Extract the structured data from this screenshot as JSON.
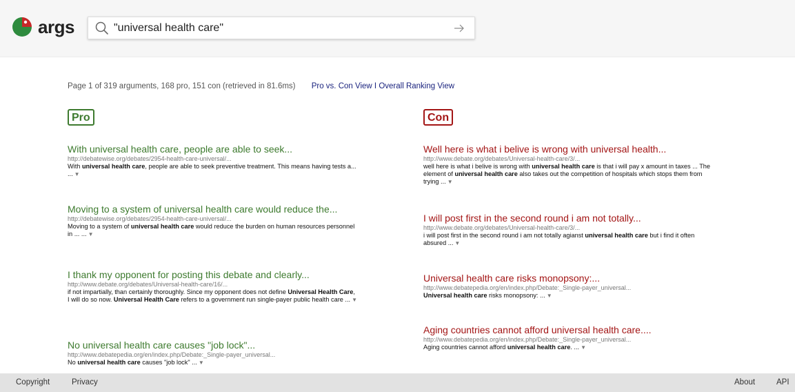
{
  "header": {
    "logo_text": "args",
    "search_value": "\"universal health care\""
  },
  "meta": {
    "summary": "Page 1 of 319 arguments, 168 pro, 151 con (retrieved in 81.6ms)",
    "view_pro_con": "Pro vs. Con View",
    "separator": "I",
    "view_ranking": "Overall Ranking View"
  },
  "pro": {
    "label": "Pro",
    "results": [
      {
        "title": "With universal health care, people are able to seek...",
        "url": "http://debatewise.org/debates/2954-health-care-universal/...",
        "snippet": [
          {
            "t": "With "
          },
          {
            "t": "universal health care",
            "b": true
          },
          {
            "t": ", people are able to seek preventive treatment. This means having tests a... ..."
          }
        ]
      },
      {
        "title": "Moving to a system of universal health care would reduce the...",
        "url": "http://debatewise.org/debates/2954-health-care-universal/...",
        "snippet": [
          {
            "t": "Moving to a system of "
          },
          {
            "t": "universal health care",
            "b": true
          },
          {
            "t": " would reduce the burden on human resources personnel in ... ..."
          }
        ]
      },
      {
        "title": "I thank my opponent for posting this debate and clearly...",
        "url": "http://www.debate.org/debates/Universal-health-care/16/...",
        "snippet": [
          {
            "t": "if not impartially, than certainly thoroughly. Since my opponent does not define "
          },
          {
            "t": "Universal Health Care",
            "b": true
          },
          {
            "t": ", I will do so now. "
          },
          {
            "t": "Universal Health Care",
            "b": true
          },
          {
            "t": " refers to a government run single-payer public health care ..."
          }
        ]
      },
      {
        "title": "No universal health care causes \"job lock\"...",
        "url": "http://www.debatepedia.org/en/index.php/Debate:_Single-payer_universal...",
        "snippet": [
          {
            "t": "No "
          },
          {
            "t": "universal health care",
            "b": true
          },
          {
            "t": " causes \"job lock\" ..."
          }
        ]
      }
    ]
  },
  "con": {
    "label": "Con",
    "results": [
      {
        "title": "Well here is what i belive is wrong with universal health...",
        "url": "http://www.debate.org/debates/Universal-health-care/3/...",
        "snippet": [
          {
            "t": "well here is what i belive is wrong with "
          },
          {
            "t": "universal health care",
            "b": true
          },
          {
            "t": " is that i will pay x amount in taxes ... The element of "
          },
          {
            "t": "universal health care",
            "b": true
          },
          {
            "t": " also takes out the competition of hospitals which stops them from trying ..."
          }
        ]
      },
      {
        "title": "I will post first in the second round i am not totally...",
        "url": "http://www.debate.org/debates/Universal-health-care/3/...",
        "snippet": [
          {
            "t": "i will post first in the second round i am not totally agianst "
          },
          {
            "t": "universal health care",
            "b": true
          },
          {
            "t": " but i find it often absured ..."
          }
        ]
      },
      {
        "title": "Universal health care risks monopsony:...",
        "url": "http://www.debatepedia.org/en/index.php/Debate:_Single-payer_universal...",
        "snippet": [
          {
            "t": "Universal health care",
            "b": true
          },
          {
            "t": " risks monopsony: ..."
          }
        ]
      },
      {
        "title": "Aging countries cannot afford universal health care....",
        "url": "http://www.debatepedia.org/en/index.php/Debate:_Single-payer_universal...",
        "snippet": [
          {
            "t": "Aging countries cannot afford "
          },
          {
            "t": "universal health care",
            "b": true
          },
          {
            "t": ". ..."
          }
        ]
      }
    ]
  },
  "footer": {
    "copyright": "Copyright",
    "privacy": "Privacy",
    "about": "About",
    "api": "API"
  },
  "colors": {
    "pro": "#3d7a2e",
    "con": "#a31515",
    "link": "#1a237e",
    "header_bg": "#f6f6f6",
    "footer_bg": "#e2e2e2"
  }
}
